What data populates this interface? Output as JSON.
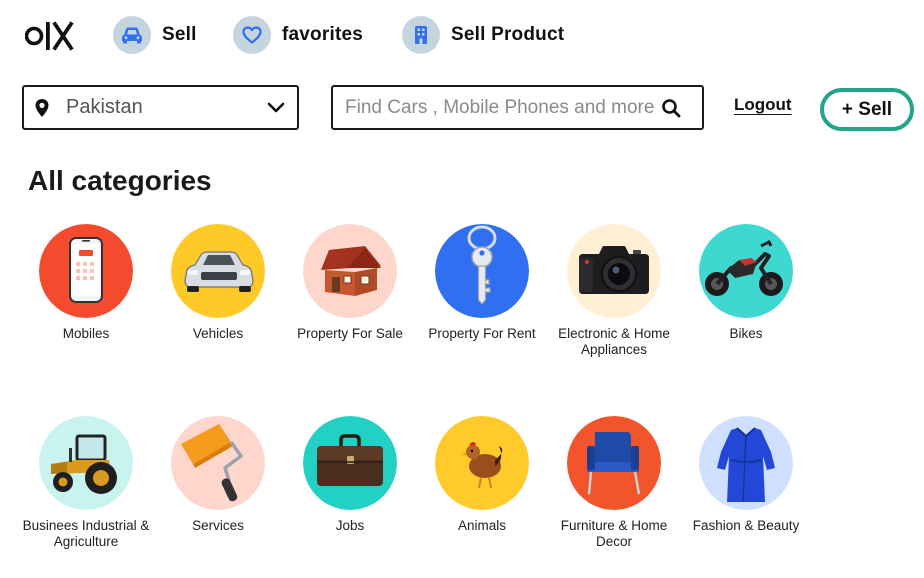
{
  "brand": {
    "logo_text": "OLX"
  },
  "nav": {
    "sell_label": "Sell",
    "favorites_label": "favorites",
    "sell_product_label": "Sell Product"
  },
  "location": {
    "value": "Pakistan"
  },
  "search": {
    "placeholder": "Find Cars , Mobile Phones and more..."
  },
  "actions": {
    "logout_label": "Logout",
    "sell_button_label": "+ Sell"
  },
  "heading": "All categories",
  "categories": [
    {
      "label": "Mobiles",
      "icon": "mobile-phone-icon",
      "color": "#f44b2f"
    },
    {
      "label": "Vehicles",
      "icon": "car-icon",
      "color": "#ffc928"
    },
    {
      "label": "Property For Sale",
      "icon": "house-icon",
      "color": "#ffd6cc"
    },
    {
      "label": "Property For Rent",
      "icon": "key-icon",
      "color": "#2f6ff0"
    },
    {
      "label": "Electronic & Home Appliances",
      "icon": "camera-icon",
      "color": "#fff0d4"
    },
    {
      "label": "Bikes",
      "icon": "motorbike-icon",
      "color": "#3fd8d1"
    },
    {
      "label": "Businees Industrial & Agriculture",
      "icon": "tractor-icon",
      "color": "#c9f3ef"
    },
    {
      "label": "Services",
      "icon": "paint-roller-icon",
      "color": "#ffd6cc"
    },
    {
      "label": "Jobs",
      "icon": "briefcase-icon",
      "color": "#23d1c4"
    },
    {
      "label": "Animals",
      "icon": "hen-icon",
      "color": "#ffcb2a"
    },
    {
      "label": "Furniture & Home Decor",
      "icon": "armchair-icon",
      "color": "#f2542c"
    },
    {
      "label": "Fashion & Beauty",
      "icon": "dress-icon",
      "color": "#cfe0ff"
    }
  ]
}
